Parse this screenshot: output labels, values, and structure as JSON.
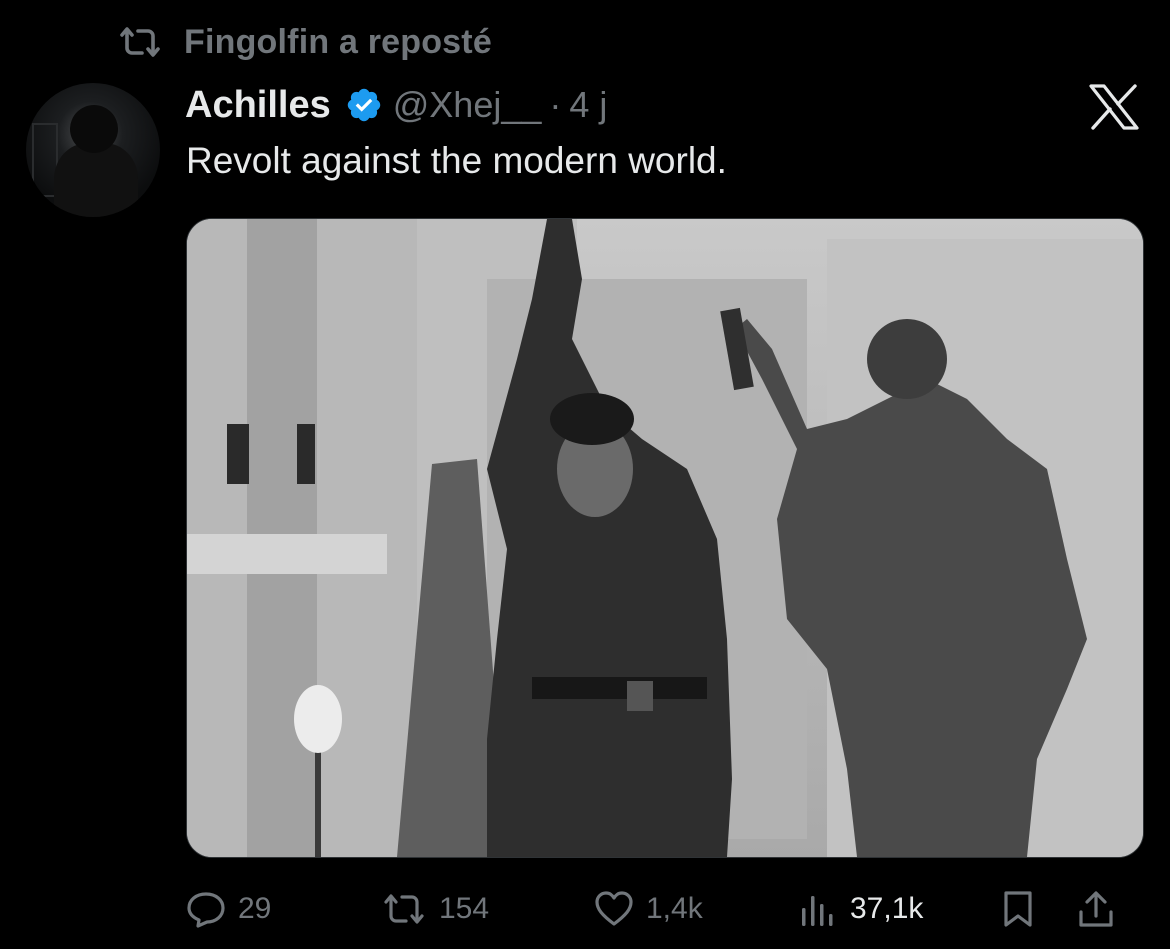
{
  "repost": {
    "label": "Fingolfin a reposté",
    "icon": "repost-icon"
  },
  "author": {
    "name": "Achilles",
    "handle": "@Xhej__",
    "separator": "·",
    "time": "4 j",
    "verified": true,
    "verified_color": "#1d9bf0"
  },
  "tweet": {
    "text": "Revolt against the modern world."
  },
  "actions": {
    "replies": "29",
    "reposts": "154",
    "likes": "1,4k",
    "views": "37,1k"
  },
  "colors": {
    "background": "#000000",
    "text": "#e7e9ea",
    "muted": "#71767b",
    "accent": "#1d9bf0"
  }
}
